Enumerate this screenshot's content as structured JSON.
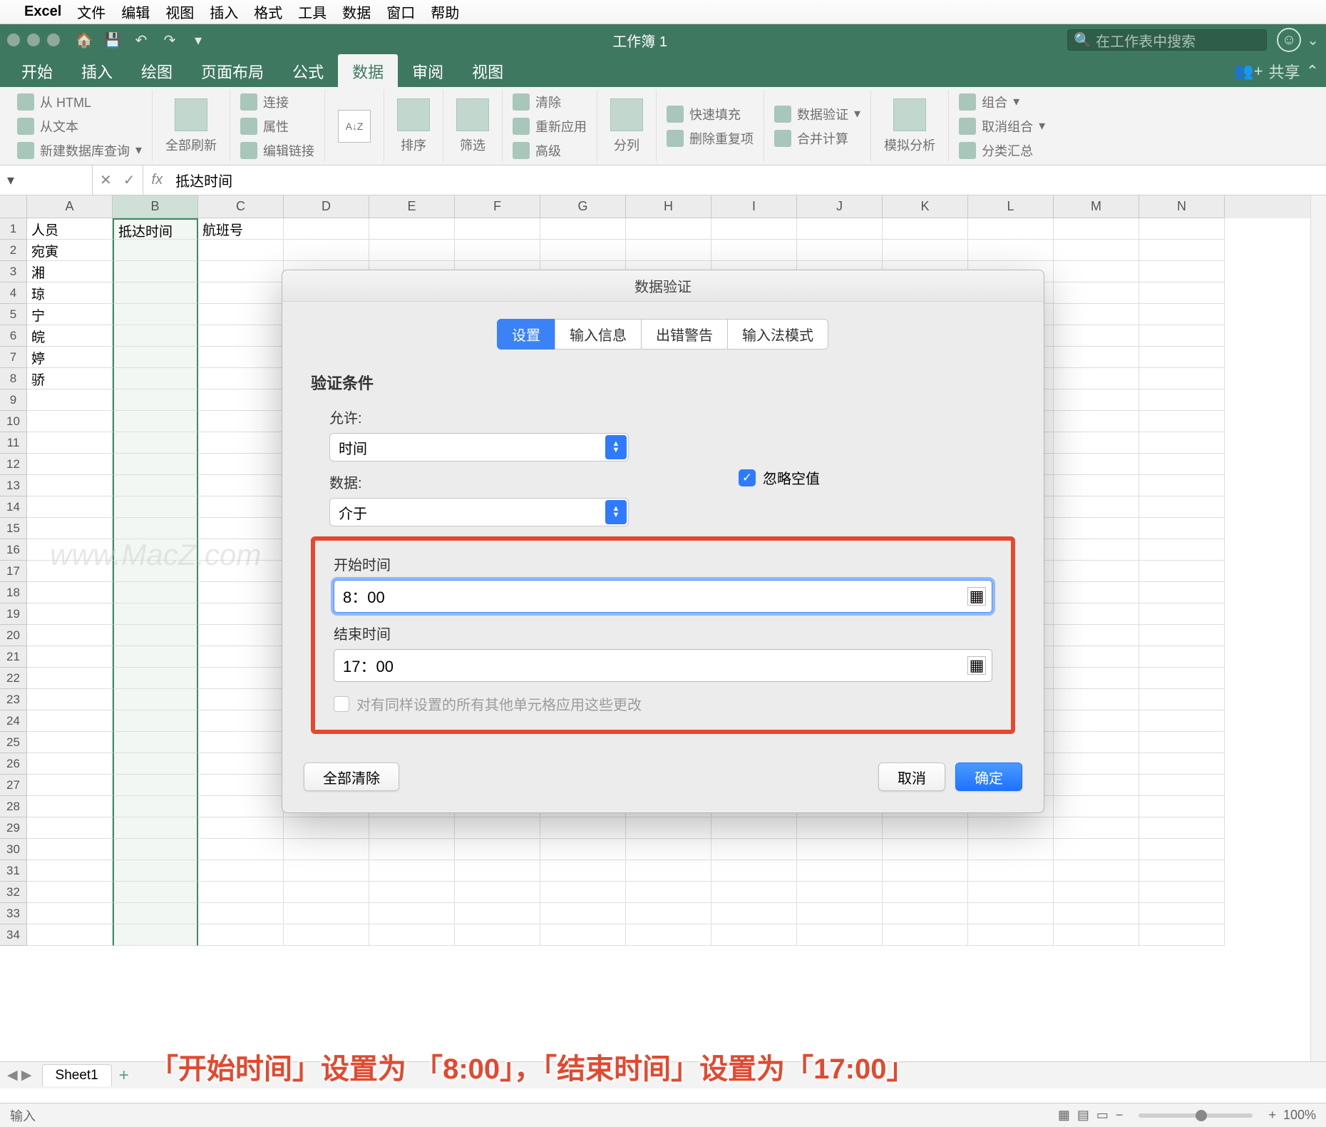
{
  "menubar": {
    "app": "Excel",
    "items": [
      "文件",
      "编辑",
      "视图",
      "插入",
      "格式",
      "工具",
      "数据",
      "窗口",
      "帮助"
    ]
  },
  "titlebar": {
    "title": "工作簿 1",
    "search_placeholder": "在工作表中搜索"
  },
  "ribbon_tabs": {
    "items": [
      "开始",
      "插入",
      "绘图",
      "页面布局",
      "公式",
      "数据",
      "审阅",
      "视图"
    ],
    "active": "数据",
    "share": "共享"
  },
  "ribbon": {
    "g1": [
      "从 HTML",
      "从文本",
      "新建数据库查询"
    ],
    "g2_big": "全部刷新",
    "g2": [
      "连接",
      "属性",
      "编辑链接"
    ],
    "g3_big": "排序",
    "g3b_big": "筛选",
    "g3c": [
      "清除",
      "重新应用",
      "高级"
    ],
    "g4_big": "分列",
    "g4": [
      "快速填充",
      "删除重复项"
    ],
    "g5": [
      "数据验证",
      "合并计算"
    ],
    "g5b_big": "模拟分析",
    "g6": [
      "组合",
      "取消组合",
      "分类汇总"
    ]
  },
  "formula_bar": {
    "value": "抵达时间"
  },
  "columns": [
    "A",
    "B",
    "C",
    "D",
    "E",
    "F",
    "G",
    "H",
    "I",
    "J",
    "K",
    "L",
    "M",
    "N"
  ],
  "cells": {
    "A1": "人员",
    "B1": "抵达时间",
    "C1": "航班号",
    "A2": "宛寅",
    "A3": "湘",
    "A4": "琼",
    "A5": "宁",
    "A6": "皖",
    "A7": "婷",
    "A8": "骄"
  },
  "row_count": 34,
  "watermark": "www.MacZ.com",
  "dialog": {
    "title": "数据验证",
    "tabs": [
      "设置",
      "输入信息",
      "出错警告",
      "输入法模式"
    ],
    "active_tab": "设置",
    "section": "验证条件",
    "allow_label": "允许:",
    "allow_value": "时间",
    "ignore_blank": "忽略空值",
    "data_label": "数据:",
    "data_value": "介于",
    "start_label": "开始时间",
    "start_value": "8：00",
    "end_label": "结束时间",
    "end_value": "17：00",
    "apply_all": "对有同样设置的所有其他单元格应用这些更改",
    "clear_all": "全部清除",
    "cancel": "取消",
    "ok": "确定"
  },
  "sheet": {
    "name": "Sheet1"
  },
  "status": {
    "mode": "输入",
    "zoom": "100%"
  },
  "annotation": "「开始时间」设置为 「8:00」，「结束时间」设置为「17:00」"
}
